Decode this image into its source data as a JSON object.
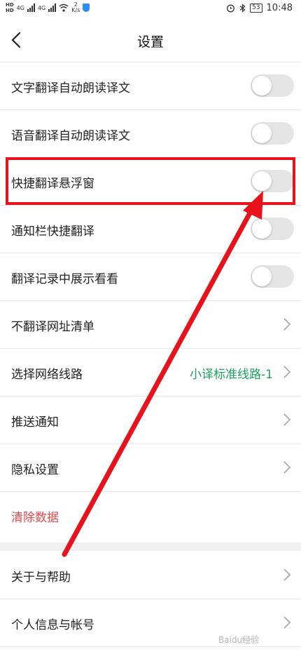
{
  "statusbar": {
    "net1": "4G",
    "net2": "4G",
    "speed_value": "2",
    "speed_unit": "K/s",
    "battery": "53",
    "time": "10:48"
  },
  "header": {
    "title": "设置"
  },
  "rows": [
    {
      "label": "文字翻译自动朗读译文",
      "type": "toggle",
      "on": false
    },
    {
      "label": "语音翻译自动朗读译文",
      "type": "toggle",
      "on": false
    },
    {
      "label": "快捷翻译悬浮窗",
      "type": "toggle",
      "on": false
    },
    {
      "label": "通知栏快捷翻译",
      "type": "toggle",
      "on": false
    },
    {
      "label": "翻译记录中展示看看",
      "type": "toggle",
      "on": false
    },
    {
      "label": "不翻译网址清单",
      "type": "link"
    },
    {
      "label": "选择网络线路",
      "type": "link",
      "value": "小译标准线路-1"
    },
    {
      "label": "推送通知",
      "type": "link"
    },
    {
      "label": "隐私设置",
      "type": "link"
    },
    {
      "label": "清除数据",
      "type": "action"
    },
    {
      "label": "关于与帮助",
      "type": "link"
    },
    {
      "label": "个人信息与帐号",
      "type": "link"
    }
  ],
  "watermark": "Baidu经验",
  "colors": {
    "accent_green": "#1aa260",
    "danger_red": "#e8484a",
    "annotation_red": "#e8121c"
  },
  "icons": [
    "back-arrow-icon",
    "chevron-right-icon",
    "bluetooth-icon",
    "alarm-icon",
    "wifi-icon",
    "shield-icon"
  ]
}
